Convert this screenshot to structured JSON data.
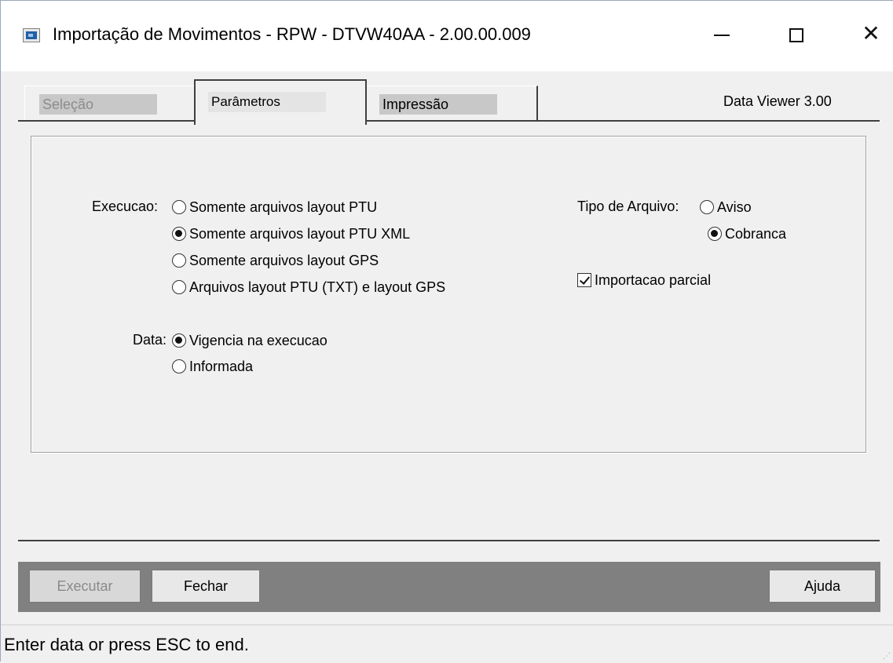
{
  "window": {
    "title": "Importação de Movimentos - RPW - DTVW40AA - 2.00.00.009",
    "min_glyph": "",
    "close_glyph": "✕"
  },
  "tabs": [
    {
      "label": "Seleção",
      "state": "disabled"
    },
    {
      "label": "Parâmetros",
      "state": "active"
    },
    {
      "label": "Impressão",
      "state": "inactive"
    }
  ],
  "data_viewer": "Data Viewer 3.00",
  "execucao": {
    "label": "Execucao:",
    "options": [
      {
        "label": "Somente arquivos layout PTU",
        "selected": false
      },
      {
        "label": "Somente arquivos layout PTU XML",
        "selected": true
      },
      {
        "label": "Somente arquivos layout GPS",
        "selected": false
      },
      {
        "label": "Arquivos layout PTU (TXT) e layout GPS",
        "selected": false
      }
    ]
  },
  "data": {
    "label": "Data:",
    "options": [
      {
        "label": "Vigencia na execucao",
        "selected": true
      },
      {
        "label": "Informada",
        "selected": false
      }
    ]
  },
  "tipo_arquivo": {
    "label": "Tipo de Arquivo:",
    "options": [
      {
        "label": "Aviso",
        "selected": false
      },
      {
        "label": "Cobranca",
        "selected": true
      }
    ]
  },
  "importacao_parcial": {
    "label": "Importacao parcial",
    "checked": true
  },
  "buttons": {
    "executar": "Executar",
    "fechar": "Fechar",
    "ajuda": "Ajuda"
  },
  "status": "Enter data or press ESC to end."
}
